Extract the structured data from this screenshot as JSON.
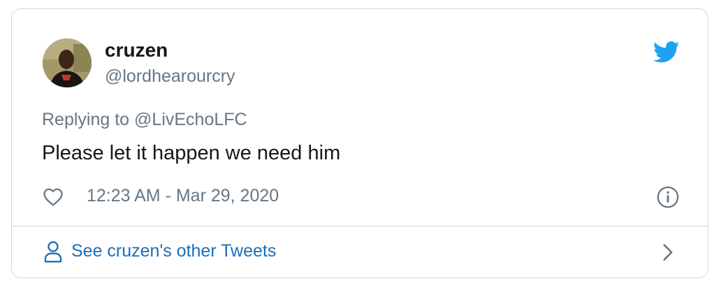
{
  "tweet": {
    "display_name": "cruzen",
    "handle": "@lordhearourcry",
    "replying_prefix": "Replying to ",
    "replying_to": "@LivEchoLFC",
    "text": "Please let it happen we need him",
    "timestamp": "12:23 AM - Mar 29, 2020"
  },
  "footer": {
    "link_text": "See cruzen's other Tweets"
  },
  "icons": {
    "brand": "twitter-bird-icon",
    "like": "heart-icon",
    "info": "info-icon",
    "profile": "person-icon",
    "more": "chevron-right-icon"
  },
  "colors": {
    "twitter_blue": "#1da1f2",
    "link_blue": "#1b6fb6",
    "secondary_text": "#657786",
    "primary_text": "#14171a",
    "border": "#cfd9de"
  }
}
